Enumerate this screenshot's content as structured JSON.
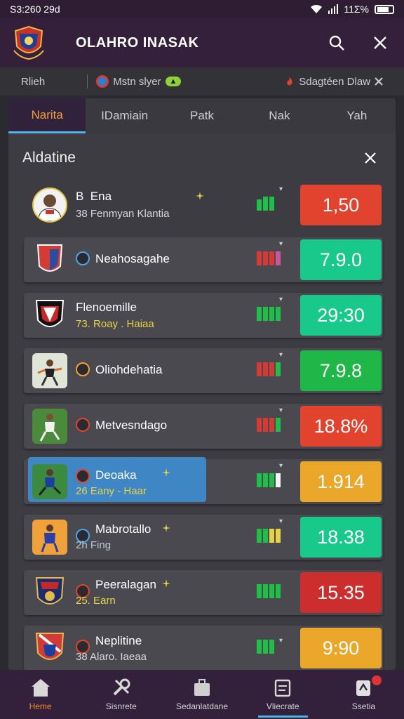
{
  "status": {
    "time": "S3:260 29d",
    "battery": "11Σ%"
  },
  "app": {
    "title": "OLAHRO INASAK"
  },
  "subbar": {
    "left": "Rlieh",
    "filter": "Mstn slyer",
    "right": "Sdagtéen Dlaw"
  },
  "tabs": [
    "Narita",
    "IDamiain",
    "Patk",
    "Nak",
    "Yah"
  ],
  "panel": {
    "title": "Aldatine"
  },
  "rows": [
    {
      "name": "Ena",
      "name_prefix": "B",
      "sub": "38 Fenmyan Klantia",
      "score": "1,50",
      "score_color": "#e2432e"
    },
    {
      "name": "Neahosagahe",
      "sub": "",
      "score": "7.9.0",
      "score_color": "#19c98b"
    },
    {
      "name": "Flenoemille",
      "sub": "73. Roay . Haiaa",
      "score": "29:30",
      "score_color": "#19c98b"
    },
    {
      "name": "Oliohdehatia",
      "sub": "",
      "score": "7.9.8",
      "score_color": "#1fb848"
    },
    {
      "name": "Metvesndago",
      "sub": "",
      "score": "18.8%",
      "score_color": "#e2432e"
    },
    {
      "name": "Deoaka",
      "sub": "26 Eany - Haar",
      "score": "1.914",
      "score_color": "#eaa72a"
    },
    {
      "name": "Mabrotallo",
      "sub": "2h Fing",
      "score": "18.38",
      "score_color": "#19c98b"
    },
    {
      "name": "Peeralagan",
      "sub": "25. Earn",
      "score": "15.35",
      "score_color": "#cc2e2e"
    },
    {
      "name": "Neplitine",
      "sub": "38 Alaro. Iaeaa",
      "score": "9:90",
      "score_color": "#eaa72a"
    }
  ],
  "nav": [
    "Heme",
    "Sisnrete",
    "Sedanlatdane",
    "Vliecrate",
    "Ssetia"
  ]
}
